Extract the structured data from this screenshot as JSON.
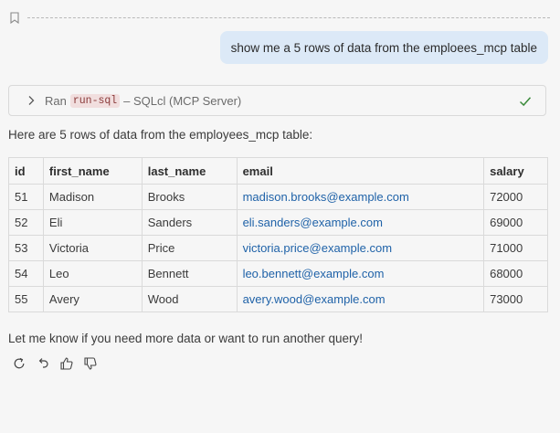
{
  "user_message": "show me a 5 rows of data from the emploees_mcp table",
  "tool_call": {
    "prefix": "Ran",
    "tool_name": "run-sql",
    "suffix": "– SQLcl (MCP Server)"
  },
  "response": {
    "intro": "Here are 5 rows of data from the employees_mcp table:",
    "outro": "Let me know if you need more data or want to run another query!"
  },
  "table": {
    "headers": [
      "id",
      "first_name",
      "last_name",
      "email",
      "salary"
    ],
    "rows": [
      [
        "51",
        "Madison",
        "Brooks",
        "madison.brooks@example.com",
        "72000"
      ],
      [
        "52",
        "Eli",
        "Sanders",
        "eli.sanders@example.com",
        "69000"
      ],
      [
        "53",
        "Victoria",
        "Price",
        "victoria.price@example.com",
        "71000"
      ],
      [
        "54",
        "Leo",
        "Bennett",
        "leo.bennett@example.com",
        "68000"
      ],
      [
        "55",
        "Avery",
        "Wood",
        "avery.wood@example.com",
        "73000"
      ]
    ]
  },
  "icons": {
    "bookmark": "bookmark-icon",
    "chevron": "chevron-right-icon",
    "check": "check-icon",
    "retry": "retry-icon",
    "undo": "undo-icon",
    "thumbs_up": "thumbs-up-icon",
    "thumbs_down": "thumbs-down-icon"
  },
  "colors": {
    "user_bubble": "#dce9f7",
    "link": "#1f62a8",
    "success": "#3a8a3a",
    "code_bg": "#f1dede"
  }
}
